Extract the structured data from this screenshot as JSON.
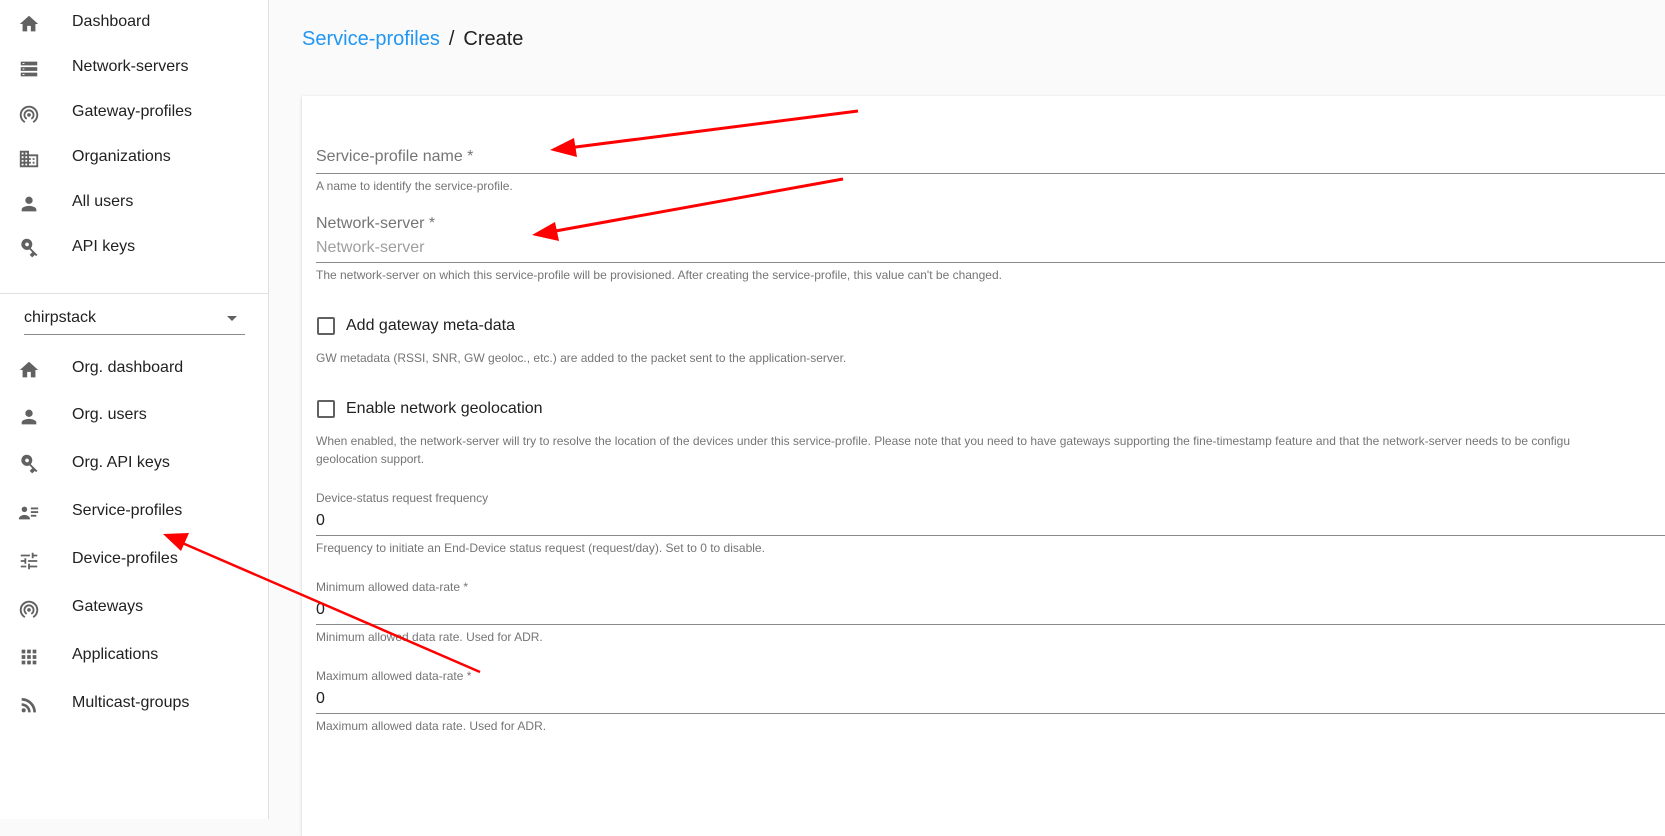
{
  "sidebar": {
    "items": [
      {
        "label": "Dashboard",
        "icon": "home-icon"
      },
      {
        "label": "Network-servers",
        "icon": "server-icon"
      },
      {
        "label": "Gateway-profiles",
        "icon": "wifi-tethering-icon"
      },
      {
        "label": "Organizations",
        "icon": "domain-icon"
      },
      {
        "label": "All users",
        "icon": "person-icon"
      },
      {
        "label": "API keys",
        "icon": "key-icon"
      }
    ],
    "org_select": {
      "value": "chirpstack"
    },
    "org_items": [
      {
        "label": "Org. dashboard",
        "icon": "home-icon"
      },
      {
        "label": "Org. users",
        "icon": "person-icon"
      },
      {
        "label": "Org. API keys",
        "icon": "key-icon"
      },
      {
        "label": "Service-profiles",
        "icon": "account-details-icon"
      },
      {
        "label": "Device-profiles",
        "icon": "tune-icon"
      },
      {
        "label": "Gateways",
        "icon": "wifi-tethering-icon"
      },
      {
        "label": "Applications",
        "icon": "apps-icon"
      },
      {
        "label": "Multicast-groups",
        "icon": "rss-icon"
      }
    ]
  },
  "breadcrumb": {
    "parent": "Service-profiles",
    "separator": "/",
    "current": "Create"
  },
  "form": {
    "name": {
      "label": "Service-profile name *",
      "helper": "A name to identify the service-profile."
    },
    "network_server": {
      "label": "Network-server *",
      "placeholder": "Network-server",
      "helper": "The network-server on which this service-profile will be provisioned. After creating the service-profile, this value can't be changed."
    },
    "gw_metadata": {
      "label": "Add gateway meta-data",
      "checked": false,
      "helper": "GW metadata (RSSI, SNR, GW geoloc., etc.) are added to the packet sent to the application-server."
    },
    "geolocation": {
      "label": "Enable network geolocation",
      "checked": false,
      "helper": "When enabled, the network-server will try to resolve the location of the devices under this service-profile. Please note that you need to have gateways supporting the fine-timestamp feature and that the network-server needs to be configu",
      "helper_line2": "geolocation support."
    },
    "dev_status_freq": {
      "label": "Device-status request frequency",
      "value": "0",
      "helper": "Frequency to initiate an End-Device status request (request/day). Set to 0 to disable."
    },
    "min_dr": {
      "label": "Minimum allowed data-rate *",
      "value": "0",
      "helper": "Minimum allowed data rate. Used for ADR."
    },
    "max_dr": {
      "label": "Maximum allowed data-rate *",
      "value": "0",
      "helper": "Maximum allowed data rate. Used for ADR."
    }
  },
  "annotation_color": "#ff0000"
}
